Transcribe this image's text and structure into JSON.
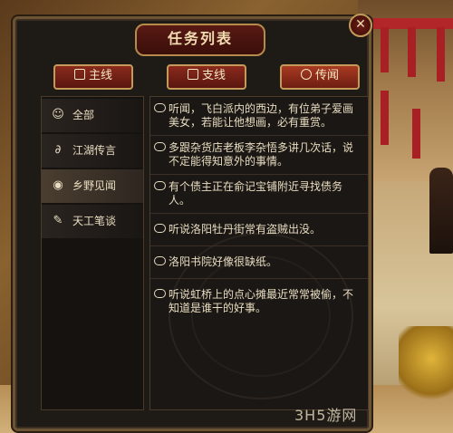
{
  "window": {
    "title": "任务列表",
    "close_glyph": "✕"
  },
  "tabs": [
    {
      "label": "主线",
      "icon": "flag-icon"
    },
    {
      "label": "支线",
      "icon": "search-icon"
    },
    {
      "label": "传闻",
      "icon": "speech-bubble-icon"
    }
  ],
  "categories": [
    {
      "label": "全部",
      "icon": "speech-bubble-icon",
      "glyph": "☺"
    },
    {
      "label": "江湖传言",
      "icon": "ear-icon",
      "glyph": "∂"
    },
    {
      "label": "乡野见闻",
      "icon": "eye-icon",
      "glyph": "◉"
    },
    {
      "label": "天工笔谈",
      "icon": "brush-icon",
      "glyph": "✎"
    }
  ],
  "rumors": [
    "听闻，飞白派内的西边，有位弟子爱画美女，若能让他想画，必有重赏。",
    "多跟杂货店老板李杂悟多讲几次话，说不定能得知意外的事情。",
    "有个债主正在俞记宝铺附近寻找债务人。",
    "听说洛阳牡丹街常有盗贼出没。",
    "洛阳书院好像很缺纸。",
    "听说虹桥上的点心摊最近常常被偷，不知道是谁干的好事。"
  ],
  "watermark": "3H5游网"
}
